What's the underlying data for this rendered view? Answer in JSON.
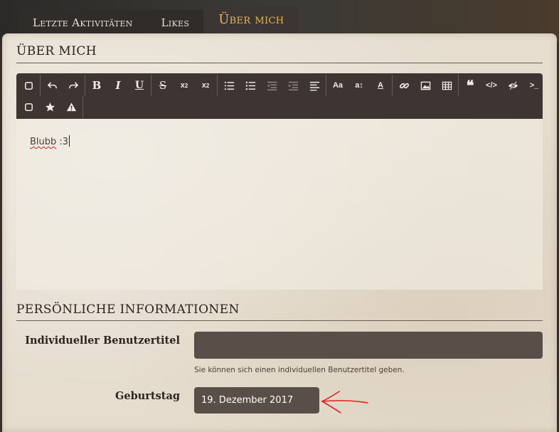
{
  "tabs": [
    {
      "label": "Letzte Aktivitäten",
      "active": false
    },
    {
      "label": "Likes",
      "active": false
    },
    {
      "label": "Über mich",
      "active": true
    }
  ],
  "about": {
    "section_title": "ÜBER MICH",
    "editor_text_word": "Blubb",
    "editor_text_rest": " :3"
  },
  "toolbar_icons": [
    "checkbox-icon",
    "undo-icon",
    "redo-icon",
    "bold-icon",
    "italic-icon",
    "underline-icon",
    "strikethrough-icon",
    "subscript-icon",
    "superscript-icon",
    "ordered-list-icon",
    "unordered-list-icon",
    "outdent-icon",
    "indent-icon",
    "align-icon",
    "font-size-icon",
    "line-height-icon",
    "text-color-icon",
    "link-icon",
    "image-icon",
    "table-icon",
    "quote-icon",
    "code-icon",
    "spoiler-icon",
    "terminal-icon",
    "checkbox-icon",
    "star-icon",
    "warning-icon"
  ],
  "personal": {
    "section_title": "PERSÖNLICHE INFORMATIONEN",
    "user_title_label": "Individueller Benutzertitel",
    "user_title_value": "",
    "user_title_hint": "Sie können sich einen individuellen Benutzertitel geben.",
    "birthday_label": "Geburtstag",
    "birthday_value": "19. Dezember 2017"
  },
  "colors": {
    "active_tab": "#e7b658",
    "toolbar_bg": "#3e3431",
    "input_bg": "#5a4e48",
    "annotation_arrow": "#e0201c"
  }
}
